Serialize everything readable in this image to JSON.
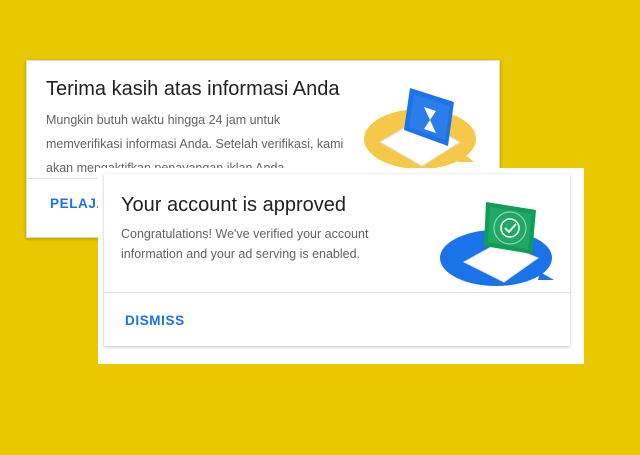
{
  "back_card": {
    "title": "Terima kasih atas informasi Anda",
    "body": "Mungkin butuh waktu hingga 24 jam untuk memverifikasi informasi Anda. Setelah verifikasi, kami akan mengaktifkan penayangan iklan Anda.",
    "action_label": "PELAJA",
    "illustration": "laptop-hourglass-icon"
  },
  "front_card": {
    "title": "Your account is approved",
    "body": "Congratulations! We've verified your account information and your ad serving is enabled.",
    "action_label": "DISMISS",
    "illustration": "laptop-approved-check-icon"
  },
  "colors": {
    "background": "#e8c800",
    "accent": "#1a73e8",
    "back_illustration_circle": "#f6c84a",
    "front_illustration_circle": "#1a73e8",
    "approved_green": "#0f9d58"
  }
}
